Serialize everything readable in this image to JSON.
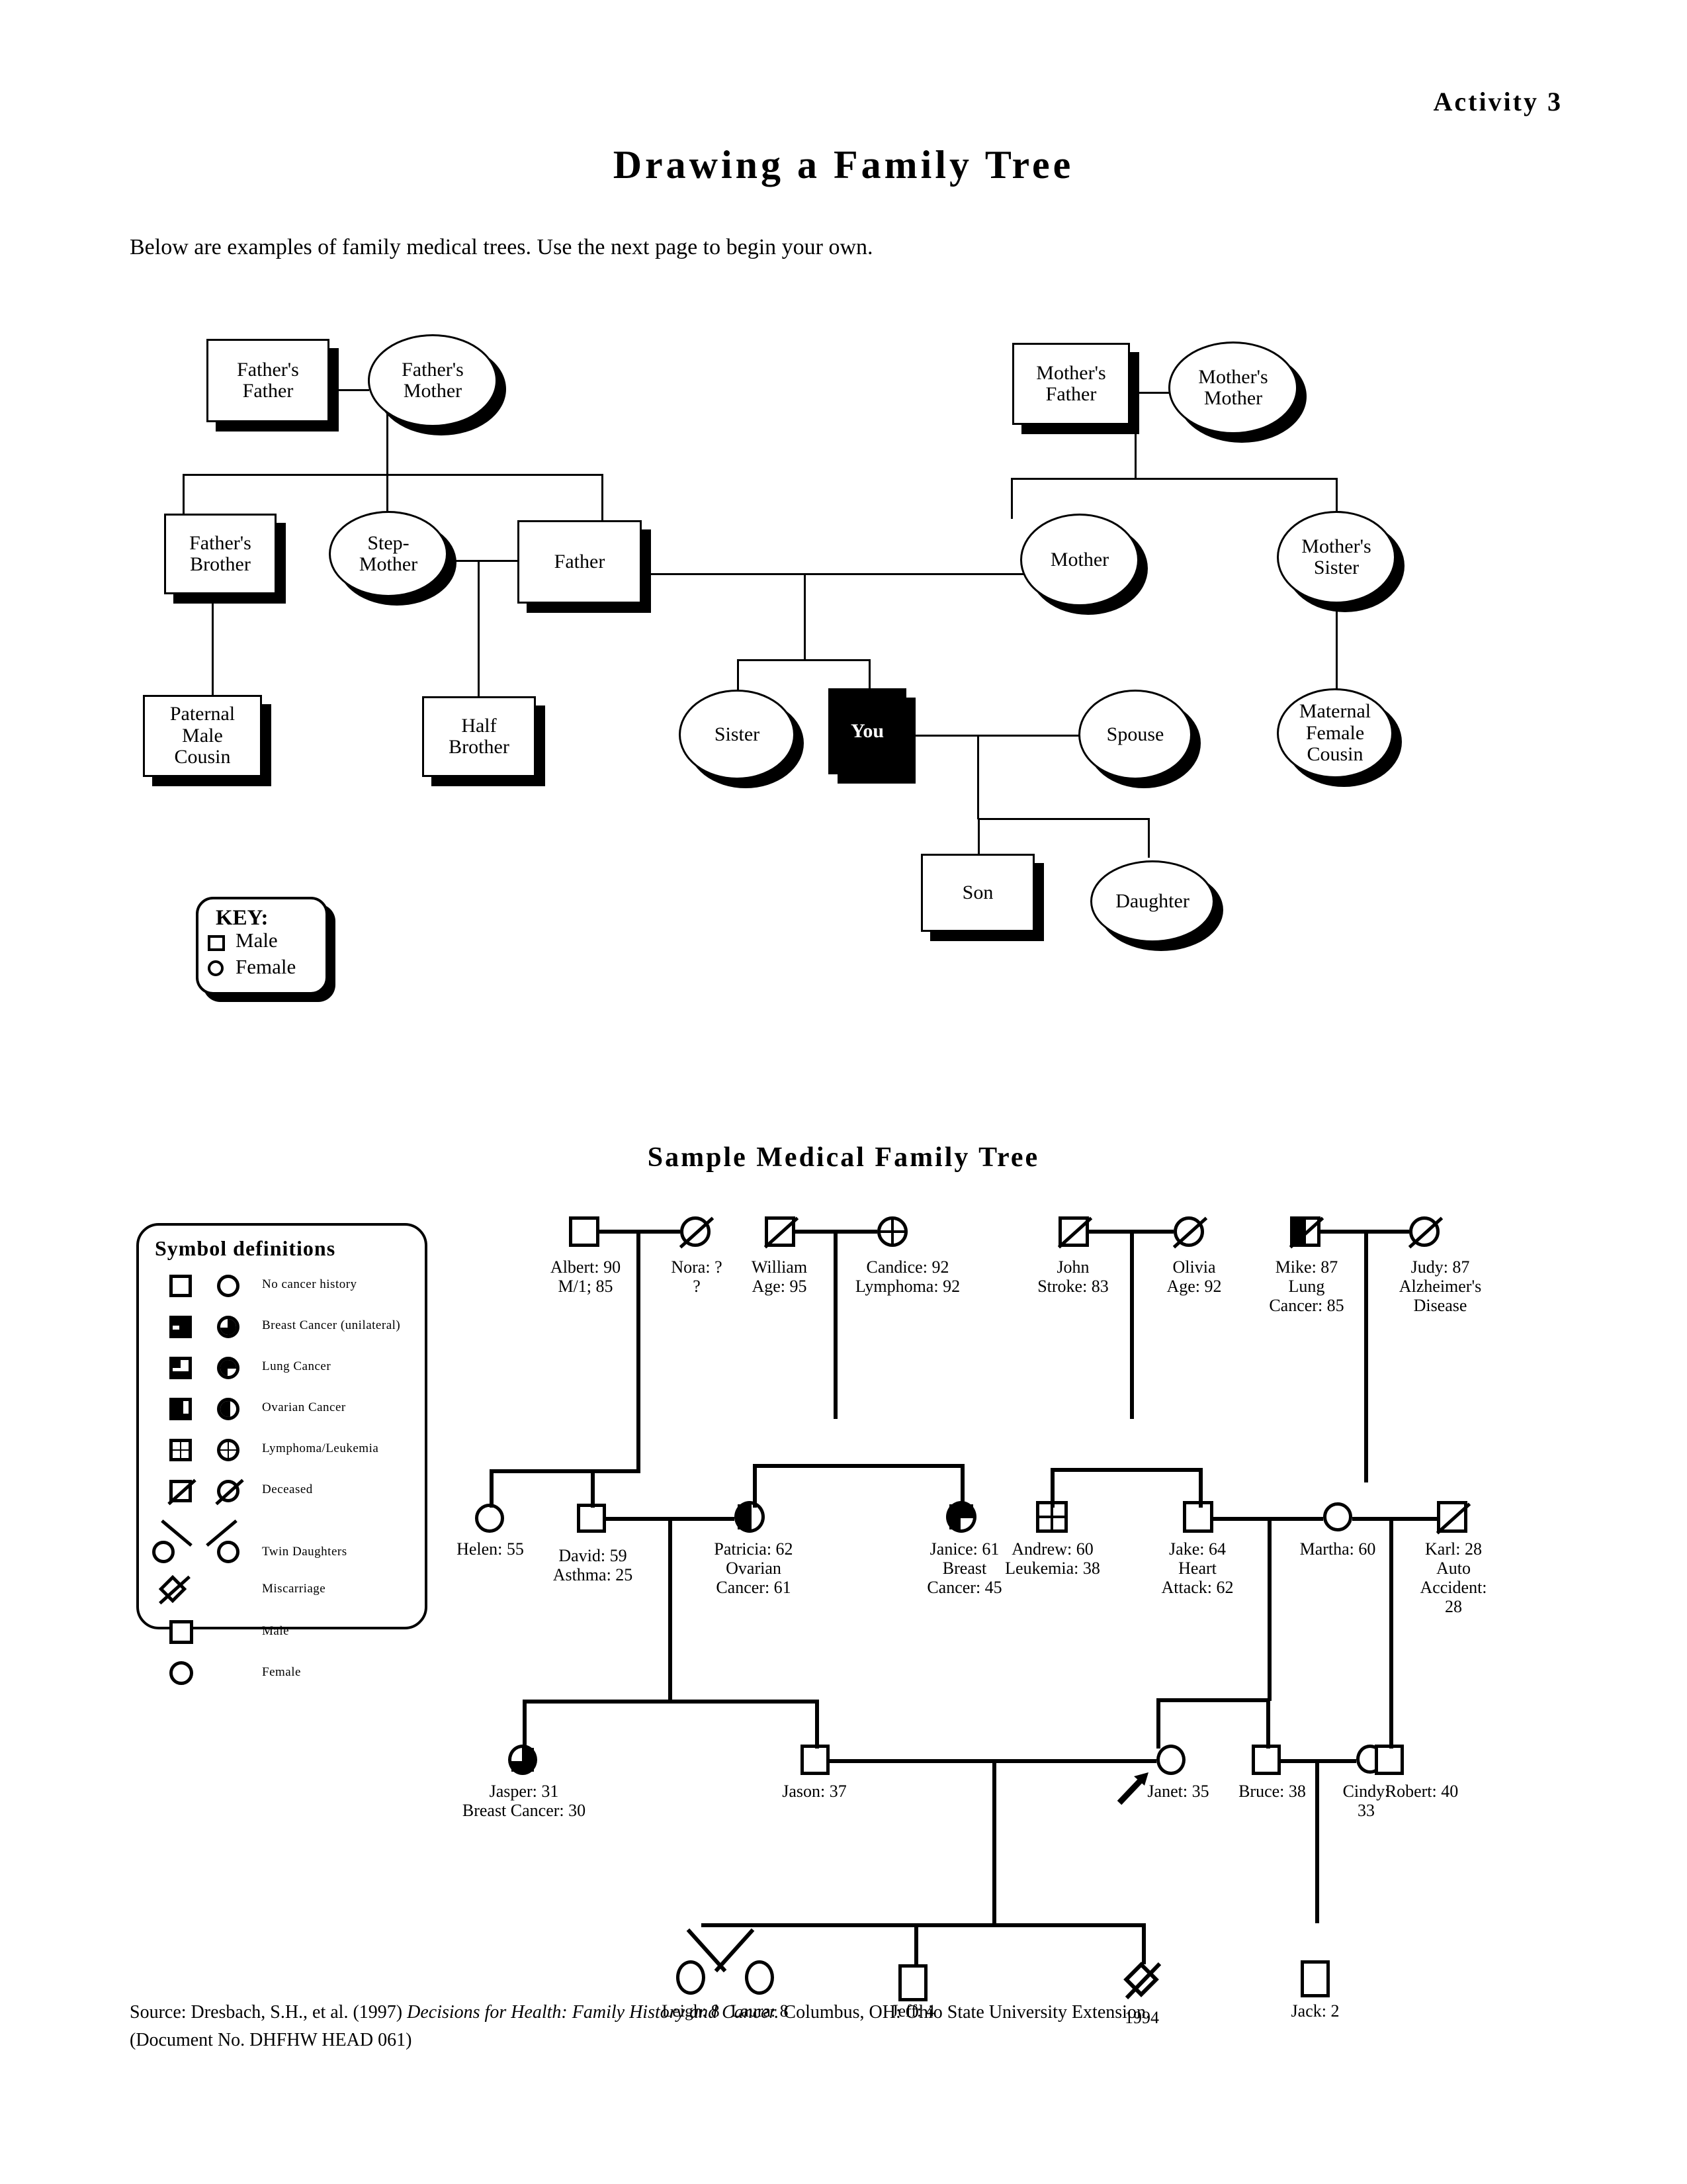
{
  "header": {
    "activity_label": "Activity  3",
    "title": "Drawing  a  Family  Tree",
    "intro": "Below are examples of family medical trees. Use the next page to begin your own."
  },
  "generic_tree": {
    "nodes": {
      "fathers_father": "Father's\nFather",
      "fathers_mother": "Father's\nMother",
      "mothers_father": "Mother's\nFather",
      "mothers_mother": "Mother's\nMother",
      "fathers_brother": "Father's\nBrother",
      "step_mother": "Step-\nMother",
      "father": "Father",
      "mother": "Mother",
      "mothers_sister": "Mother's\nSister",
      "paternal_male_cousin": "Paternal\nMale\nCousin",
      "half_brother": "Half\nBrother",
      "sister": "Sister",
      "you": "You",
      "spouse": "Spouse",
      "maternal_female_cousin": "Maternal\nFemale\nCousin",
      "son": "Son",
      "daughter": "Daughter"
    },
    "key": {
      "title": "KEY:",
      "male": "Male",
      "female": "Female"
    }
  },
  "medical_tree": {
    "section_title": "Sample  Medical  Family  Tree",
    "symbol_definitions": {
      "title": "Symbol   definitions",
      "items": [
        {
          "label": "No cancer history",
          "shape": "empty"
        },
        {
          "label": "Breast Cancer (unilateral)",
          "shape": "quarter"
        },
        {
          "label": "Lung Cancer",
          "shape": "three-quarter"
        },
        {
          "label": "Ovarian Cancer",
          "shape": "half"
        },
        {
          "label": "Lymphoma/Leukemia",
          "shape": "crossed-quadrants"
        },
        {
          "label": "Deceased",
          "shape": "slashed"
        },
        {
          "label": "Twin Daughters",
          "shape": "twin-circles"
        },
        {
          "label": "Miscarriage",
          "shape": "small-slashed-diamond"
        },
        {
          "label": "Male",
          "shape": "square"
        },
        {
          "label": "Female",
          "shape": "circle"
        }
      ]
    },
    "people": [
      {
        "id": "albert",
        "sex": "male",
        "status": "alive",
        "fill": "empty",
        "lines": [
          "Albert: 90",
          "M/1; 85"
        ]
      },
      {
        "id": "nora",
        "sex": "female",
        "status": "deceased",
        "fill": "empty",
        "lines": [
          "Nora: ?",
          "?"
        ]
      },
      {
        "id": "william",
        "sex": "male",
        "status": "deceased",
        "fill": "empty",
        "lines": [
          "William",
          "Age: 95"
        ]
      },
      {
        "id": "candice",
        "sex": "female",
        "status": "alive",
        "fill": "crossed-quadrants",
        "lines": [
          "Candice: 92",
          "Lymphoma: 92"
        ]
      },
      {
        "id": "john",
        "sex": "male",
        "status": "deceased",
        "fill": "empty",
        "lines": [
          "John",
          "Stroke: 83"
        ]
      },
      {
        "id": "olivia",
        "sex": "female",
        "status": "deceased",
        "fill": "empty",
        "lines": [
          "Olivia",
          "Age: 92"
        ]
      },
      {
        "id": "mike",
        "sex": "male",
        "status": "deceased",
        "fill": "half",
        "lines": [
          "Mike: 87",
          "Lung",
          "Cancer: 85"
        ]
      },
      {
        "id": "judy",
        "sex": "female",
        "status": "deceased",
        "fill": "empty",
        "lines": [
          "Judy: 87",
          "Alzheimer's",
          "Disease"
        ]
      },
      {
        "id": "helen",
        "sex": "female",
        "status": "alive",
        "fill": "empty",
        "lines": [
          "Helen: 55"
        ]
      },
      {
        "id": "david",
        "sex": "male",
        "status": "alive",
        "fill": "empty",
        "lines": [
          "David: 59",
          "Asthma: 25"
        ]
      },
      {
        "id": "patricia",
        "sex": "female",
        "status": "alive",
        "fill": "half",
        "lines": [
          "Patricia: 62",
          "Ovarian",
          "Cancer: 61"
        ]
      },
      {
        "id": "janice",
        "sex": "female",
        "status": "alive",
        "fill": "three-quarter",
        "lines": [
          "Janice: 61",
          "Breast",
          "Cancer: 45"
        ]
      },
      {
        "id": "andrew",
        "sex": "male",
        "status": "alive",
        "fill": "crossed-quadrants",
        "lines": [
          "Andrew: 60",
          "Leukemia: 38"
        ]
      },
      {
        "id": "jake",
        "sex": "male",
        "status": "alive",
        "fill": "empty",
        "lines": [
          "Jake: 64",
          "Heart",
          "Attack: 62"
        ]
      },
      {
        "id": "martha",
        "sex": "female",
        "status": "alive",
        "fill": "empty",
        "lines": [
          "Martha: 60"
        ]
      },
      {
        "id": "karl",
        "sex": "male",
        "status": "deceased",
        "fill": "empty",
        "lines": [
          "Karl: 28",
          "Auto",
          "Accident:",
          "28"
        ]
      },
      {
        "id": "jasper",
        "sex": "female",
        "status": "alive",
        "fill": "quarter",
        "lines": [
          "Jasper: 31",
          "Breast Cancer: 30"
        ]
      },
      {
        "id": "jason",
        "sex": "male",
        "status": "alive",
        "fill": "empty",
        "lines": [
          "Jason: 37"
        ]
      },
      {
        "id": "janet",
        "sex": "female",
        "status": "alive",
        "fill": "empty",
        "lines": [
          "Janet: 35"
        ],
        "proband": true
      },
      {
        "id": "bruce",
        "sex": "male",
        "status": "alive",
        "fill": "empty",
        "lines": [
          "Bruce: 38"
        ]
      },
      {
        "id": "cindy",
        "sex": "female",
        "status": "alive",
        "fill": "empty",
        "lines": [
          "Cindy:",
          "33"
        ]
      },
      {
        "id": "robert",
        "sex": "male",
        "status": "alive",
        "fill": "empty",
        "lines": [
          "Robert: 40"
        ]
      },
      {
        "id": "leigh",
        "sex": "female",
        "status": "alive",
        "fill": "empty",
        "lines": [
          "Leigh: 8"
        ]
      },
      {
        "id": "laura",
        "sex": "female",
        "status": "alive",
        "fill": "empty",
        "lines": [
          "Laura: 8"
        ]
      },
      {
        "id": "jeff",
        "sex": "male",
        "status": "alive",
        "fill": "empty",
        "lines": [
          "Jeff: 4"
        ]
      },
      {
        "id": "miscarriage_1994",
        "sex": "unknown",
        "status": "miscarriage",
        "fill": "empty",
        "lines": [
          "1994"
        ]
      },
      {
        "id": "jack",
        "sex": "male",
        "status": "alive",
        "fill": "empty",
        "lines": [
          "Jack: 2"
        ]
      }
    ]
  },
  "footer": {
    "line1_a": "Source: Dresbach, S.H., et al. (1997) ",
    "line1_i": "Decisions for Health: Family History and Cancer.",
    "line1_b": " Columbus, OH: Ohio State University Extension.",
    "line2": "(Document No. DHFHW HEAD 061)"
  }
}
